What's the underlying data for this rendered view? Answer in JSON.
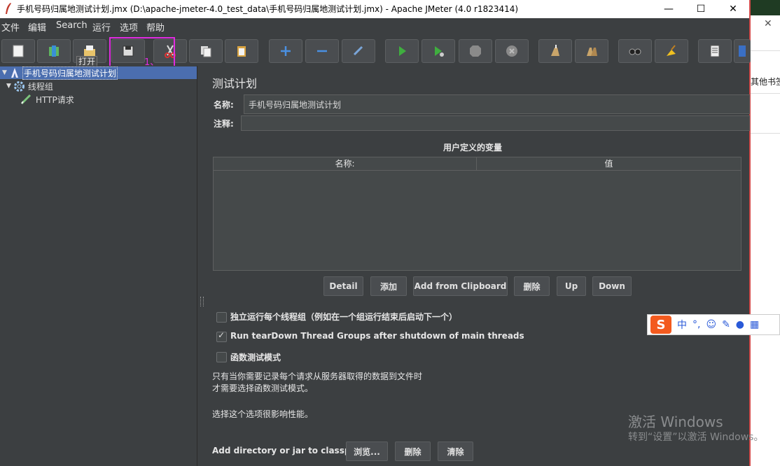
{
  "window": {
    "title": "手机号码归属地测试计划.jmx (D:\\apache-jmeter-4.0_test_data\\手机号码归属地测试计划.jmx) - Apache JMeter (4.0 r1823414)",
    "minimize": "—",
    "maximize": "☐",
    "close": "✕"
  },
  "menu": {
    "items": [
      "文件",
      "编辑",
      "Search",
      "运行",
      "选项",
      "帮助"
    ]
  },
  "toolbar": {
    "tooltip": "打开",
    "annotation": "1、",
    "buttons": [
      "new-icon",
      "templates-icon",
      "open-icon",
      "save-icon",
      "cut-icon",
      "copy-icon",
      "paste-icon",
      "expand-icon",
      "collapse-icon",
      "toggle-icon",
      "start-icon",
      "start-no-pause-icon",
      "stop-icon",
      "shutdown-icon",
      "clear-icon",
      "clear-all-icon",
      "search-icon",
      "reset-search-icon",
      "function-helper-icon",
      "help-icon"
    ]
  },
  "tree": {
    "items": [
      {
        "label": "手机号码归属地测试计划",
        "icon": "test-plan-icon",
        "selected": true
      },
      {
        "label": "线程组",
        "icon": "thread-group-gear-icon"
      },
      {
        "label": "HTTP请求",
        "icon": "sampler-pen-icon"
      }
    ]
  },
  "panel": {
    "title": "测试计划",
    "name_label": "名称:",
    "name_value": "手机号码归属地测试计划",
    "comment_label": "注释:",
    "comment_value": "",
    "variables_title": "用户定义的变量",
    "col_name": "名称:",
    "col_value": "值",
    "buttons": {
      "detail": "Detail",
      "add": "添加",
      "add_clipboard": "Add from Clipboard",
      "delete": "删除",
      "up": "Up",
      "down": "Down"
    },
    "opt_serial": "独立运行每个线程组（例如在一个组运行结束后启动下一个）",
    "opt_serial_checked": false,
    "opt_teardown": "Run tearDown Thread Groups after shutdown of main threads",
    "opt_teardown_checked": true,
    "opt_functional": "函数测试模式",
    "opt_functional_checked": false,
    "note1": "只有当你需要记录每个请求从服务器取得的数据到文件时",
    "note2": "才需要选择函数测试模式。",
    "note3": "选择这个选项很影响性能。",
    "classpath_label": "Add directory or jar to classpath",
    "browse": "浏览...",
    "cp_delete": "删除",
    "cp_clear": "清除"
  },
  "overlay": {
    "watermark_line1": "激活 Windows",
    "watermark_line2": "转到“设置”以激活 Windows。",
    "bookmark": "其他书签",
    "ime_logo": "S",
    "ime_cn": "中",
    "ime_punct": "°,",
    "ime_icons": [
      "emoji-icon",
      "skin-icon",
      "mic-icon",
      "toolbox-icon"
    ]
  },
  "colors": {
    "background": "#3c3f41",
    "selection": "#4b6eaf",
    "highlight_box": "#e02be0"
  }
}
